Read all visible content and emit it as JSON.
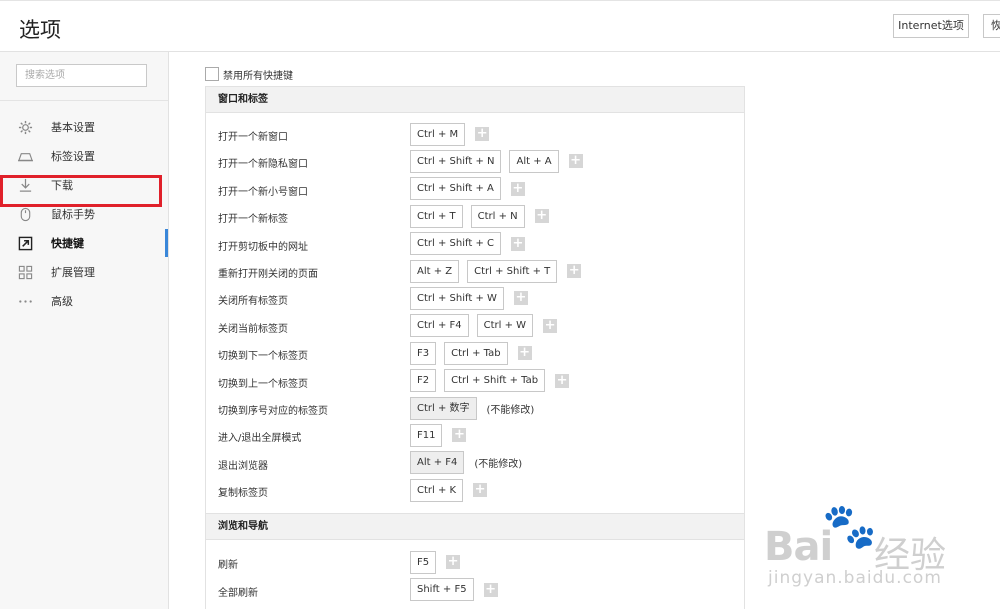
{
  "header": {
    "title": "选项",
    "internet_button": "Internet选项",
    "restore_button": "恢"
  },
  "sidebar": {
    "search_placeholder": "搜索选项",
    "items": [
      {
        "label": "基本设置",
        "icon": "gear-icon"
      },
      {
        "label": "标签设置",
        "icon": "tab-icon"
      },
      {
        "label": "下载",
        "icon": "download-icon"
      },
      {
        "label": "鼠标手势",
        "icon": "mouse-icon"
      },
      {
        "label": "快捷键",
        "icon": "shortcut-arrow-icon",
        "active": true
      },
      {
        "label": "扩展管理",
        "icon": "extensions-grid-icon"
      },
      {
        "label": "高级",
        "icon": "more-dots-icon"
      }
    ]
  },
  "main": {
    "disable_all_label": "禁用所有快捷键",
    "disable_all_checked": false,
    "sections": [
      {
        "title": "窗口和标签",
        "rows": [
          {
            "name": "打开一个新窗口",
            "keys": [
              "Ctrl + M"
            ],
            "addable": true
          },
          {
            "name": "打开一个新隐私窗口",
            "keys": [
              "Ctrl + Shift + N",
              "Alt + A"
            ],
            "addable": true
          },
          {
            "name": "打开一个新小号窗口",
            "keys": [
              "Ctrl + Shift + A"
            ],
            "addable": true
          },
          {
            "name": "打开一个新标签",
            "keys": [
              "Ctrl + T",
              "Ctrl + N"
            ],
            "addable": true
          },
          {
            "name": "打开剪切板中的网址",
            "keys": [
              "Ctrl + Shift + C"
            ],
            "addable": true
          },
          {
            "name": "重新打开刚关闭的页面",
            "keys": [
              "Alt + Z",
              "Ctrl + Shift + T"
            ],
            "addable": true
          },
          {
            "name": "关闭所有标签页",
            "keys": [
              "Ctrl + Shift + W"
            ],
            "addable": true
          },
          {
            "name": "关闭当前标签页",
            "keys": [
              "Ctrl + F4",
              "Ctrl + W"
            ],
            "addable": true
          },
          {
            "name": "切换到下一个标签页",
            "keys": [
              "F3",
              "Ctrl + Tab"
            ],
            "addable": true
          },
          {
            "name": "切换到上一个标签页",
            "keys": [
              "F2",
              "Ctrl + Shift + Tab"
            ],
            "addable": true
          },
          {
            "name": "切换到序号对应的标签页",
            "keys": [
              "Ctrl + 数字"
            ],
            "locked": true,
            "note": "(不能修改)"
          },
          {
            "name": "进入/退出全屏模式",
            "keys": [
              "F11"
            ],
            "addable": true
          },
          {
            "name": "退出浏览器",
            "keys": [
              "Alt + F4"
            ],
            "locked": true,
            "note": "(不能修改)"
          },
          {
            "name": "复制标签页",
            "keys": [
              "Ctrl + K"
            ],
            "addable": true
          }
        ]
      },
      {
        "title": "浏览和导航",
        "rows": [
          {
            "name": "刷新",
            "keys": [
              "F5"
            ],
            "addable": true
          },
          {
            "name": "全部刷新",
            "keys": [
              "Shift + F5"
            ],
            "addable": true
          }
        ]
      }
    ]
  },
  "watermark": {
    "brand": "Bai",
    "brand_suffix": "经验",
    "url": "jingyan.baidu.com"
  }
}
